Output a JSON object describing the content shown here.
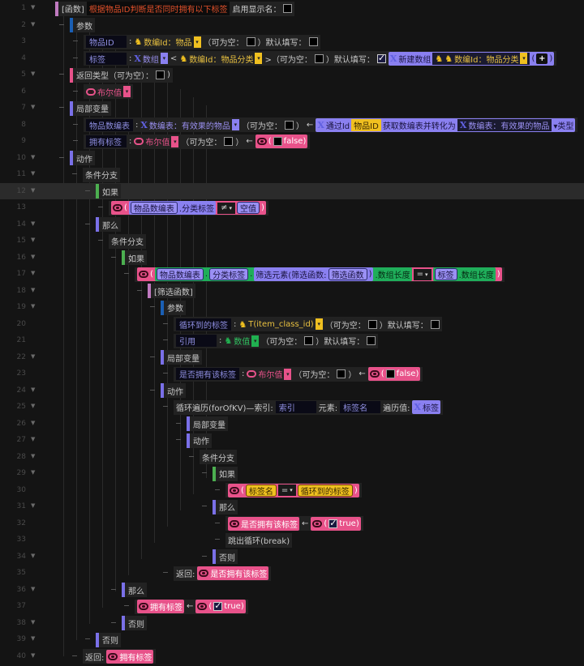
{
  "colors": {
    "func": "#c07ac0",
    "blue": "#1a5fb4",
    "pink": "#e8528a",
    "purple": "#7a70e8",
    "green": "#4caf50"
  },
  "rows": [
    {
      "n": "1",
      "arrow": true,
      "bar": "func",
      "tokens": [
        {
          "t": "p",
          "v": "[函数]"
        },
        {
          "t": "title",
          "v": "根据物品ID判断是否同时拥有以下标签"
        },
        {
          "t": "p",
          "v": "启用显示名："
        },
        {
          "t": "cb"
        }
      ]
    },
    {
      "n": "2",
      "arrow": true,
      "bar": "blue",
      "tokens": [
        {
          "t": "p",
          "v": "参数"
        }
      ]
    },
    {
      "n": "3",
      "tokens": [
        {
          "t": "field",
          "v": "物品ID"
        },
        {
          "t": "p",
          "v": ":"
        },
        {
          "t": "ty",
          "v": "数编Id：物品"
        },
        {
          "t": "p",
          "v": "（可为空："
        },
        {
          "t": "cb"
        },
        {
          "t": "p",
          "v": "）默认填写："
        },
        {
          "t": "cb"
        }
      ]
    },
    {
      "n": "4",
      "tokens": [
        {
          "t": "field",
          "v": "标签"
        },
        {
          "t": "p",
          "v": ":"
        },
        {
          "t": "tx",
          "v": "数组"
        },
        {
          "t": "p",
          "v": "<"
        },
        {
          "t": "ty",
          "v": "数编Id：物品分类"
        },
        {
          "t": "p",
          "v": ">（可为空："
        },
        {
          "t": "cb"
        },
        {
          "t": "p",
          "v": "）默认填写："
        },
        {
          "t": "cb",
          "on": true
        },
        {
          "t": "purple",
          "c": [
            {
              "t": "x"
            },
            {
              "t": "p",
              "v": "新建数组"
            },
            {
              "t": "dark",
              "c": [
                {
                  "t": "duck"
                },
                {
                  "t": "ty",
                  "v": "数编Id：物品分类"
                }
              ]
            },
            {
              "t": "p",
              "v": "("
            },
            {
              "t": "plus"
            },
            {
              "t": "p",
              "v": ")"
            }
          ]
        }
      ]
    },
    {
      "n": "5",
      "arrow": true,
      "bar": "pink",
      "tokens": [
        {
          "t": "p",
          "v": "返回类型（可为空）："
        },
        {
          "t": "cb"
        },
        {
          "t": "p",
          "v": ")"
        }
      ]
    },
    {
      "n": "6",
      "tokens": [
        {
          "t": "tb",
          "v": "布尔值"
        }
      ]
    },
    {
      "n": "7",
      "arrow": true,
      "bar": "purple",
      "tokens": [
        {
          "t": "p",
          "v": "局部变量"
        }
      ]
    },
    {
      "n": "8",
      "tokens": [
        {
          "t": "field",
          "v": "物品数编表"
        },
        {
          "t": "p",
          "v": ":"
        },
        {
          "t": "tx",
          "v": "数编表：有效果的物品"
        },
        {
          "t": "p",
          "v": "（可为空："
        },
        {
          "t": "cb"
        },
        {
          "t": "p",
          "v": "）"
        },
        {
          "t": "arrow",
          "v": "←"
        },
        {
          "t": "purple",
          "c": [
            {
              "t": "x"
            },
            {
              "t": "p",
              "v": "通过Id"
            },
            {
              "t": "ychip",
              "v": "物品ID"
            },
            {
              "t": "p",
              "v": "获取数编表并转化为"
            },
            {
              "t": "dark",
              "c": [
                {
                  "t": "x"
                },
                {
                  "t": "p",
                  "v": "数编表：有效果的物品"
                }
              ]
            },
            {
              "t": "p",
              "v": "▾类型"
            }
          ]
        }
      ]
    },
    {
      "n": "9",
      "tokens": [
        {
          "t": "field",
          "v": "拥有标签"
        },
        {
          "t": "p",
          "v": ":"
        },
        {
          "t": "tb",
          "v": "布尔值"
        },
        {
          "t": "p",
          "v": "（可为空："
        },
        {
          "t": "cb"
        },
        {
          "t": "p",
          "v": "）"
        },
        {
          "t": "arrow",
          "v": "←"
        },
        {
          "t": "pink",
          "c": [
            {
              "t": "eye"
            },
            {
              "t": "p",
              "v": "("
            },
            {
              "t": "cb"
            },
            {
              "t": "p",
              "v": "false)"
            }
          ]
        }
      ]
    },
    {
      "n": "10",
      "arrow": true,
      "bar": "purple",
      "tokens": [
        {
          "t": "p",
          "v": "动作"
        }
      ]
    },
    {
      "n": "11",
      "arrow": true,
      "tokens": [
        {
          "t": "p",
          "v": "条件分支"
        }
      ]
    },
    {
      "n": "12",
      "arrow": true,
      "bar": "green",
      "hl": true,
      "tokens": [
        {
          "t": "p",
          "v": "如果"
        }
      ]
    },
    {
      "n": "13",
      "tokens": [
        {
          "t": "pink",
          "c": [
            {
              "t": "eye"
            },
            {
              "t": "p",
              "v": "("
            },
            {
              "t": "purple",
              "c": [
                {
                  "t": "chip",
                  "v": "物品数编表"
                },
                {
                  "t": "p",
                  "v": ".分类标签"
                }
              ]
            },
            {
              "t": "op",
              "v": "≠"
            },
            {
              "t": "chip",
              "v": "空值"
            },
            {
              "t": "p",
              "v": ")"
            }
          ]
        }
      ]
    },
    {
      "n": "14",
      "arrow": true,
      "bar": "purple",
      "tokens": [
        {
          "t": "p",
          "v": "那么"
        }
      ]
    },
    {
      "n": "15",
      "arrow": true,
      "tokens": [
        {
          "t": "p",
          "v": "条件分支"
        }
      ]
    },
    {
      "n": "16",
      "arrow": true,
      "bar": "green",
      "tokens": [
        {
          "t": "p",
          "v": "如果"
        }
      ]
    },
    {
      "n": "17",
      "arrow": true,
      "tokens": [
        {
          "t": "pink",
          "c": [
            {
              "t": "eye"
            },
            {
              "t": "p",
              "v": "("
            },
            {
              "t": "green",
              "c": [
                {
                  "t": "chip",
                  "v": "物品数编表"
                },
                {
                  "t": "p",
                  "v": "."
                },
                {
                  "t": "chip",
                  "v": "分类标签"
                },
                {
                  "t": "p",
                  "v": "."
                },
                {
                  "t": "purple",
                  "c": [
                    {
                      "t": "p",
                      "v": "筛选元素(筛选函数:"
                    },
                    {
                      "t": "chip",
                      "v": "筛选函数"
                    },
                    {
                      "t": "p",
                      "v": ")"
                    }
                  ]
                },
                {
                  "t": "p",
                  "v": ".数组长度"
                }
              ]
            },
            {
              "t": "op",
              "v": "="
            },
            {
              "t": "green",
              "c": [
                {
                  "t": "chip",
                  "v": "标签"
                },
                {
                  "t": "p",
                  "v": ".数组长度"
                }
              ]
            },
            {
              "t": "p",
              "v": ")"
            }
          ]
        }
      ]
    },
    {
      "n": "18",
      "arrow": true,
      "bar": "func",
      "tokens": [
        {
          "t": "p",
          "v": "[筛选函数]"
        }
      ]
    },
    {
      "n": "19",
      "arrow": true,
      "bar": "blue",
      "tokens": [
        {
          "t": "p",
          "v": "参数"
        }
      ]
    },
    {
      "n": "20",
      "tokens": [
        {
          "t": "field",
          "v": "循环到的标签"
        },
        {
          "t": "p",
          "v": ":"
        },
        {
          "t": "ty",
          "v": "T(item_class_id)"
        },
        {
          "t": "p",
          "v": "（可为空："
        },
        {
          "t": "cb"
        },
        {
          "t": "p",
          "v": "）默认填写："
        },
        {
          "t": "cb"
        }
      ]
    },
    {
      "n": "21",
      "tokens": [
        {
          "t": "field",
          "v": "引用"
        },
        {
          "t": "p",
          "v": ":"
        },
        {
          "t": "tg",
          "v": "数值"
        },
        {
          "t": "p",
          "v": "（可为空："
        },
        {
          "t": "cb"
        },
        {
          "t": "p",
          "v": "）默认填写："
        },
        {
          "t": "cb"
        }
      ]
    },
    {
      "n": "22",
      "arrow": true,
      "bar": "purple",
      "tokens": [
        {
          "t": "p",
          "v": "局部变量"
        }
      ]
    },
    {
      "n": "23",
      "tokens": [
        {
          "t": "field",
          "v": "是否拥有该标签"
        },
        {
          "t": "p",
          "v": ":"
        },
        {
          "t": "tb",
          "v": "布尔值"
        },
        {
          "t": "p",
          "v": "（可为空："
        },
        {
          "t": "cb"
        },
        {
          "t": "p",
          "v": "）"
        },
        {
          "t": "arrow",
          "v": "←"
        },
        {
          "t": "pink",
          "c": [
            {
              "t": "eye"
            },
            {
              "t": "p",
              "v": "("
            },
            {
              "t": "cb"
            },
            {
              "t": "p",
              "v": "false)"
            }
          ]
        }
      ]
    },
    {
      "n": "24",
      "arrow": true,
      "bar": "purple",
      "tokens": [
        {
          "t": "p",
          "v": "动作"
        }
      ]
    },
    {
      "n": "25",
      "arrow": true,
      "tokens": [
        {
          "t": "p",
          "v": "循环遍历(forOfKV)—索引:"
        },
        {
          "t": "field",
          "v": "索引"
        },
        {
          "t": "p",
          "v": "元素:"
        },
        {
          "t": "field",
          "v": "标签名"
        },
        {
          "t": "p",
          "v": "遍历值:"
        },
        {
          "t": "purple",
          "c": [
            {
              "t": "x"
            },
            {
              "t": "p",
              "v": "标签"
            }
          ]
        }
      ]
    },
    {
      "n": "26",
      "arrow": true,
      "bar": "purple",
      "tokens": [
        {
          "t": "p",
          "v": "局部变量"
        }
      ]
    },
    {
      "n": "27",
      "arrow": true,
      "bar": "purple",
      "tokens": [
        {
          "t": "p",
          "v": "动作"
        }
      ]
    },
    {
      "n": "28",
      "arrow": true,
      "tokens": [
        {
          "t": "p",
          "v": "条件分支"
        }
      ]
    },
    {
      "n": "29",
      "arrow": true,
      "bar": "green",
      "tokens": [
        {
          "t": "p",
          "v": "如果"
        }
      ]
    },
    {
      "n": "30",
      "tokens": [
        {
          "t": "pink",
          "c": [
            {
              "t": "eye"
            },
            {
              "t": "p",
              "v": "("
            },
            {
              "t": "chip",
              "y": true,
              "v": "标签名"
            },
            {
              "t": "op",
              "v": "="
            },
            {
              "t": "chip",
              "y": true,
              "v": "循环到的标签"
            },
            {
              "t": "p",
              "v": ")"
            }
          ]
        }
      ]
    },
    {
      "n": "31",
      "arrow": true,
      "bar": "purple",
      "tokens": [
        {
          "t": "p",
          "v": "那么"
        }
      ]
    },
    {
      "n": "32",
      "tokens": [
        {
          "t": "pink",
          "c": [
            {
              "t": "eye"
            },
            {
              "t": "p",
              "v": "是否拥有该标签"
            }
          ]
        },
        {
          "t": "arrow",
          "v": "←"
        },
        {
          "t": "pink",
          "c": [
            {
              "t": "eye"
            },
            {
              "t": "p",
              "v": "("
            },
            {
              "t": "cb",
              "on": true
            },
            {
              "t": "p",
              "v": "true)"
            }
          ]
        }
      ]
    },
    {
      "n": "33",
      "tokens": [
        {
          "t": "p",
          "v": "跳出循环(break)"
        }
      ]
    },
    {
      "n": "34",
      "arrow": true,
      "bar": "purple",
      "tokens": [
        {
          "t": "p",
          "v": "否则"
        }
      ]
    },
    {
      "n": "35",
      "tokens": [
        {
          "t": "p",
          "v": "返回:"
        },
        {
          "t": "pink",
          "c": [
            {
              "t": "eye"
            },
            {
              "t": "p",
              "v": "是否拥有该标签"
            }
          ]
        }
      ]
    },
    {
      "n": "36",
      "arrow": true,
      "bar": "purple",
      "tokens": [
        {
          "t": "p",
          "v": "那么"
        }
      ]
    },
    {
      "n": "37",
      "tokens": [
        {
          "t": "pink",
          "c": [
            {
              "t": "eye"
            },
            {
              "t": "p",
              "v": "拥有标签"
            }
          ]
        },
        {
          "t": "arrow",
          "v": "←"
        },
        {
          "t": "pink",
          "c": [
            {
              "t": "eye"
            },
            {
              "t": "p",
              "v": "("
            },
            {
              "t": "cb",
              "on": true
            },
            {
              "t": "p",
              "v": "true)"
            }
          ]
        }
      ]
    },
    {
      "n": "38",
      "arrow": true,
      "bar": "purple",
      "tokens": [
        {
          "t": "p",
          "v": "否则"
        }
      ]
    },
    {
      "n": "39",
      "arrow": true,
      "bar": "purple",
      "tokens": [
        {
          "t": "p",
          "v": "否则"
        }
      ]
    },
    {
      "n": "40",
      "arrow": true,
      "tokens": [
        {
          "t": "p",
          "v": "返回:"
        },
        {
          "t": "pink",
          "c": [
            {
              "t": "eye"
            },
            {
              "t": "p",
              "v": "拥有标签"
            }
          ]
        }
      ]
    }
  ]
}
